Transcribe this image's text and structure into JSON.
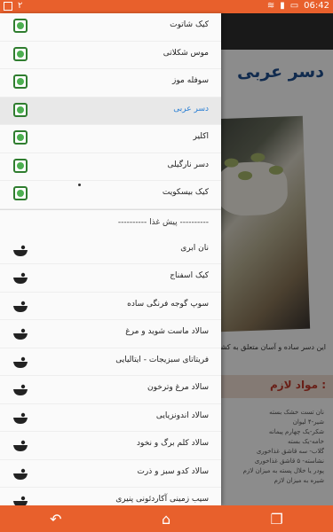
{
  "status_bar": {
    "time": "06:42",
    "notification_count": "۲"
  },
  "article": {
    "title": "دسر عربی",
    "intro": "این دسر ساده و آسان متعلق به کشورهای",
    "ingredients_heading": "مواد لازم :",
    "ingredients": [
      "نان تست  خشک  بسته",
      "شیر-۴ لیوان",
      "شکر-یک چهارم پیمانه",
      "خامه-یک بسته",
      "گلاب- سه قاشق غذاخوری",
      "نشاسته- ۵ قاشق غذاخوری",
      "پودر یا خلال پسته به میزان لازم",
      "شیره به میزان لازم"
    ]
  },
  "drawer": {
    "dessert_items": [
      {
        "label": "کیک شاتوت",
        "active": false
      },
      {
        "label": "موس شکلاتی",
        "active": false
      },
      {
        "label": "سوفله موز",
        "active": false
      },
      {
        "label": "دسر عربی",
        "active": true
      },
      {
        "label": "اکلیر",
        "active": false
      },
      {
        "label": "دسر نارگیلی",
        "active": false
      },
      {
        "label": "کیک بیسکویت",
        "active": false
      }
    ],
    "section_title": "---------- پیش غذا ----------",
    "appetizer_items": [
      {
        "label": "نان ابری"
      },
      {
        "label": "کیک اسفناج"
      },
      {
        "label": "سوپ گوجه فرنگی ساده"
      },
      {
        "label": "سالاد ماست شوید و مرغ"
      },
      {
        "label": "فریتاتای سبزیجات - ایتالیایی"
      },
      {
        "label": "سالاد مرغ وترخون"
      },
      {
        "label": "سالاد اندونزیایی"
      },
      {
        "label": "سالاد کلم برگ و نخود"
      },
      {
        "label": "سالاد کدو سبز و ذرت"
      },
      {
        "label": "سیب زمینی آکاردئونی پنیری"
      }
    ]
  },
  "nav": {
    "back_icon": "back-arrow-icon",
    "home_icon": "home-icon",
    "recents_icon": "recents-icon"
  },
  "colors": {
    "accent": "#e8602c",
    "active_text": "#2a7fd4",
    "title": "#1f4f8f"
  }
}
